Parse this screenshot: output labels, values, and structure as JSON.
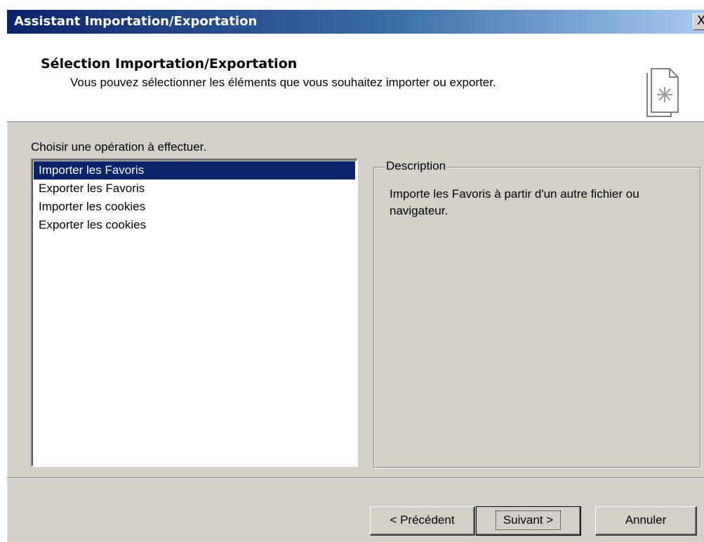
{
  "window": {
    "title": "Assistant Importation/Exportation",
    "close_label": "X"
  },
  "header": {
    "title": "Sélection Importation/Exportation",
    "subtitle": "Vous pouvez sélectionner les éléments que vous souhaitez importer ou exporter."
  },
  "operations": {
    "label": "Choisir une opération à effectuer.",
    "items": [
      {
        "label": "Importer les Favoris",
        "selected": true
      },
      {
        "label": "Exporter les Favoris",
        "selected": false
      },
      {
        "label": "Importer les cookies",
        "selected": false
      },
      {
        "label": "Exporter les cookies",
        "selected": false
      }
    ]
  },
  "description": {
    "legend": "Description",
    "text": "Importe les Favoris à partir d'un autre fichier ou navigateur."
  },
  "buttons": {
    "previous": "< Précédent",
    "next": "Suivant >",
    "cancel": "Annuler"
  },
  "colors": {
    "selection": "#0a246a",
    "dialog_face": "#d4d0c8",
    "titlebar_start": "#0a246a",
    "titlebar_end": "#a6caf0"
  },
  "icons": {
    "wizard": "wizard-page-icon"
  }
}
